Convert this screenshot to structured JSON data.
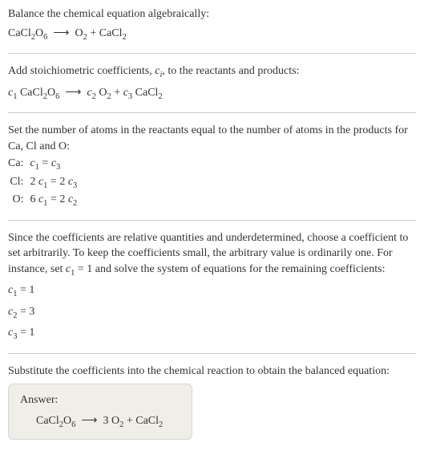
{
  "sec1": {
    "line1": "Balance the chemical equation algebraically:"
  },
  "sec2": {
    "line1_a": "Add stoichiometric coefficients, ",
    "line1_b": ", to the reactants and products:"
  },
  "sec3": {
    "intro": "Set the number of atoms in the reactants equal to the number of atoms in the products for Ca, Cl and O:",
    "rows": [
      {
        "el": "Ca:"
      },
      {
        "el": "Cl:"
      },
      {
        "el": "O:"
      }
    ]
  },
  "sec4": {
    "intro_a": "Since the coefficients are relative quantities and underdetermined, choose a coefficient to set arbitrarily. To keep the coefficients small, the arbitrary value is ordinarily one. For instance, set ",
    "intro_b": " = 1 and solve the system of equations for the remaining coefficients:"
  },
  "sec5": {
    "intro": "Substitute the coefficients into the chemical reaction to obtain the balanced equation:",
    "answer_label": "Answer:"
  }
}
